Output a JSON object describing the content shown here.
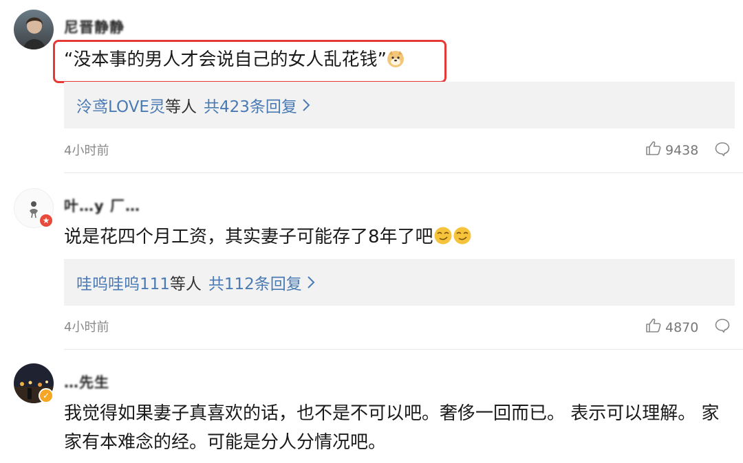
{
  "comments": [
    {
      "username": "尼晋静静",
      "text": "“没本事的男人才会说自己的女人乱花钱”",
      "emoji": [
        "doge-emoji"
      ],
      "replies": {
        "names": "泠鸢LOVE灵",
        "suffix": "等人",
        "count": "共423条回复"
      },
      "time": "4小时前",
      "likes": "9438"
    },
    {
      "username": "叶…y 厂…",
      "text": "说是花四个月工资，其实妻子可能存了8年了吧",
      "emoji": [
        "smirk-emoji",
        "smirk-emoji"
      ],
      "replies": {
        "names": "哇呜哇呜111",
        "suffix": "等人",
        "count": "共112条回复"
      },
      "time": "4小时前",
      "likes": "4870"
    },
    {
      "username": "…先生",
      "text": "我觉得如果妻子真喜欢的话，也不是不可以吧。奢侈一回而已。 表示可以理解。 家家有本难念的经。可能是分人分情况吧。"
    }
  ],
  "colors": {
    "link": "#4a7ab4",
    "highlight": "#e53935",
    "reply_bg": "#f2f2f2",
    "meta": "#888888"
  }
}
